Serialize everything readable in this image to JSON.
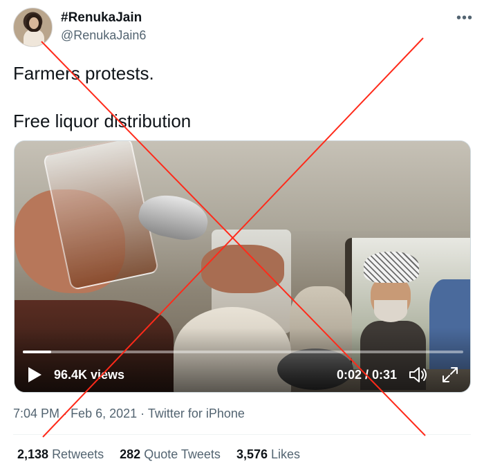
{
  "author": {
    "display_name": "#RenukaJain",
    "handle": "@RenukaJain6",
    "more_icon": "more-horizontal-icon"
  },
  "tweet": {
    "line1": "Farmers protests.",
    "line2": "Free liquor distribution"
  },
  "video": {
    "views": "96.4K views",
    "time": "0:02 / 0:31",
    "progress": 0.065,
    "icons": [
      "play-icon",
      "volume-icon",
      "expand-icon"
    ]
  },
  "meta": {
    "time": "7:04 PM",
    "date": "Feb 6, 2021",
    "source": "Twitter for iPhone"
  },
  "stats": {
    "retweets_count": "2,138",
    "retweets_label": "Retweets",
    "quotes_count": "282",
    "quotes_label": "Quote Tweets",
    "likes_count": "3,576",
    "likes_label": "Likes"
  },
  "overlay": {
    "cross_color": "#ff2a1a"
  }
}
